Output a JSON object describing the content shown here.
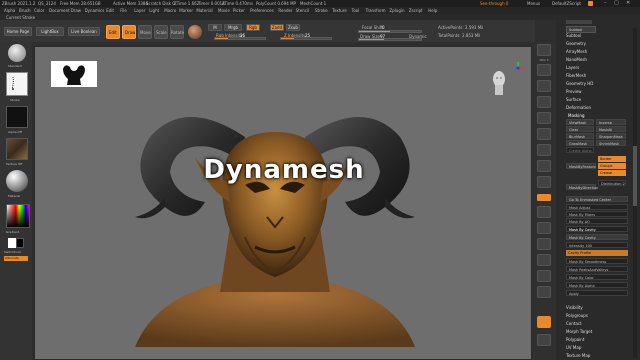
{
  "titlebar": {
    "app": "ZBrush 2021.1.2",
    "project": "QS_3124",
    "free_mem": "Free Mem 28.651GB",
    "active_mem": "Active Mem 3384",
    "scratch": "Scratch Disk 0",
    "ztime": "ZTime 1.662",
    "timer": "Timer 0.0012",
    "atime": "ATime 0.470ms",
    "polycount": "PolyCount 0.694 MP",
    "meshcount": "MeshCount 1",
    "see_through": "See-through 0",
    "menus": "Menus",
    "script": "DefaultZScript"
  },
  "menu": [
    "Alpha",
    "Brush",
    "Color",
    "Document",
    "Draw",
    "Dynamics",
    "Edit",
    "File",
    "Layer",
    "Light",
    "Macro",
    "Marker",
    "Material",
    "Movie",
    "Picker",
    "Preferences",
    "Render",
    "Stencil",
    "Stroke",
    "Texture",
    "Tool",
    "Transform",
    "Zplugin",
    "Zscript",
    "Help"
  ],
  "strokebar": {
    "label": "Current Stroke"
  },
  "toolrow": {
    "home": "Home Page",
    "lightbox": "LightBox",
    "livebool": "Live Boolean",
    "edit": "Edit",
    "draw": "Draw",
    "move": "Move",
    "scale": "Scale",
    "rotate": "Rotate",
    "mrgb": "Mrgb",
    "rgb": "Rgb",
    "m": "M",
    "zadd": "Zadd",
    "zsub": "Zsub",
    "rgb_intensity_label": "Rgb Intensity",
    "rgb_intensity_value": "26",
    "z_intensity_label": "Z Intensity",
    "z_intensity_value": "25",
    "focal_label": "Focal Shift",
    "focal_value": "0",
    "draw_size_label": "Draw Size",
    "draw_size_value": "97",
    "dynamic_label": "Dynamic",
    "active_points": "ActivePoints: 2.593 Mil",
    "total_points": "TotalPoints: 2.853 Mil"
  },
  "leftpanel": {
    "brush_label": "Standard",
    "stroke_label": "Stroke",
    "alpha_label": "Alpha Off",
    "texture_label": "Texture Off",
    "material_label": "Material",
    "gradient_label": "Gradient",
    "switch_color": "SwitchColor",
    "alternate": "Alternate"
  },
  "canvas": {
    "overlay_text": "Dynamesh"
  },
  "shelf": [
    "BPR",
    "SPix 3",
    "",
    "Persp",
    "Floor",
    "L.Sym",
    "",
    "Frame",
    "Move",
    "Zoom3D",
    "Rotate",
    "",
    "PolyF",
    "Transp",
    "Solo",
    "Xpose"
  ],
  "rightpanel": {
    "title": "Subtool",
    "subtool": "Subtool",
    "geometry": "Geometry",
    "arraymesh": "ArrayMesh",
    "nanomesh": "NanoMesh",
    "layers": "Layers",
    "fibermesh": "FiberMesh",
    "geometry_hd": "Geometry HD",
    "preview": "Preview",
    "surface": "Surface",
    "deformation": "Deformation",
    "masking": "Masking",
    "viewmask": "ViewMask",
    "inverse": "Inverse",
    "clear": "Clear",
    "maskall": "MaskAll",
    "blurmask": "BlurMask",
    "sharpenmask": "SharpenMask",
    "growmask": "GrowMask",
    "shrinkmask": "ShrinkMask",
    "createalpha": "Create Alpha",
    "border": "Border",
    "groups": "Groups",
    "crease": "Crease",
    "maskbyfeature": "MaskByFeature",
    "maskbysmoothness": "Mask By Smoothness",
    "distribution": "Distribution 2",
    "maskbydirection": "MaskByDirection",
    "goto_unmasked": "Go To Unmasked Center",
    "mask_adjust": "Mask Adjust",
    "mask_fibers": "Mask By Fibers",
    "mask_ao": "Mask By AO",
    "mask_cavity": "Mask By Cavity",
    "mask_by_cavity_btn": "Mask By Cavity",
    "intensity": "Intensity 100",
    "cavity_profile": "Cavity Profile",
    "mask_smoothness": "Mask By Smoothness",
    "mask_peaks": "Mask PeaksAndValleys",
    "mask_color": "Mask By Color",
    "mask_alpha": "Mask By Alpha",
    "apply": "Apply",
    "visibility": "Visibility",
    "polygroups": "Polygroups",
    "contact": "Contact",
    "morph_target": "Morph Target",
    "polypaint": "Polypaint",
    "uvmap": "UV Map",
    "texture_map": "Texture Map"
  },
  "colors": {
    "accent": "#e88a2a",
    "canvas_bg": "#6e6e6e",
    "panel_bg": "#2a2a2a"
  }
}
